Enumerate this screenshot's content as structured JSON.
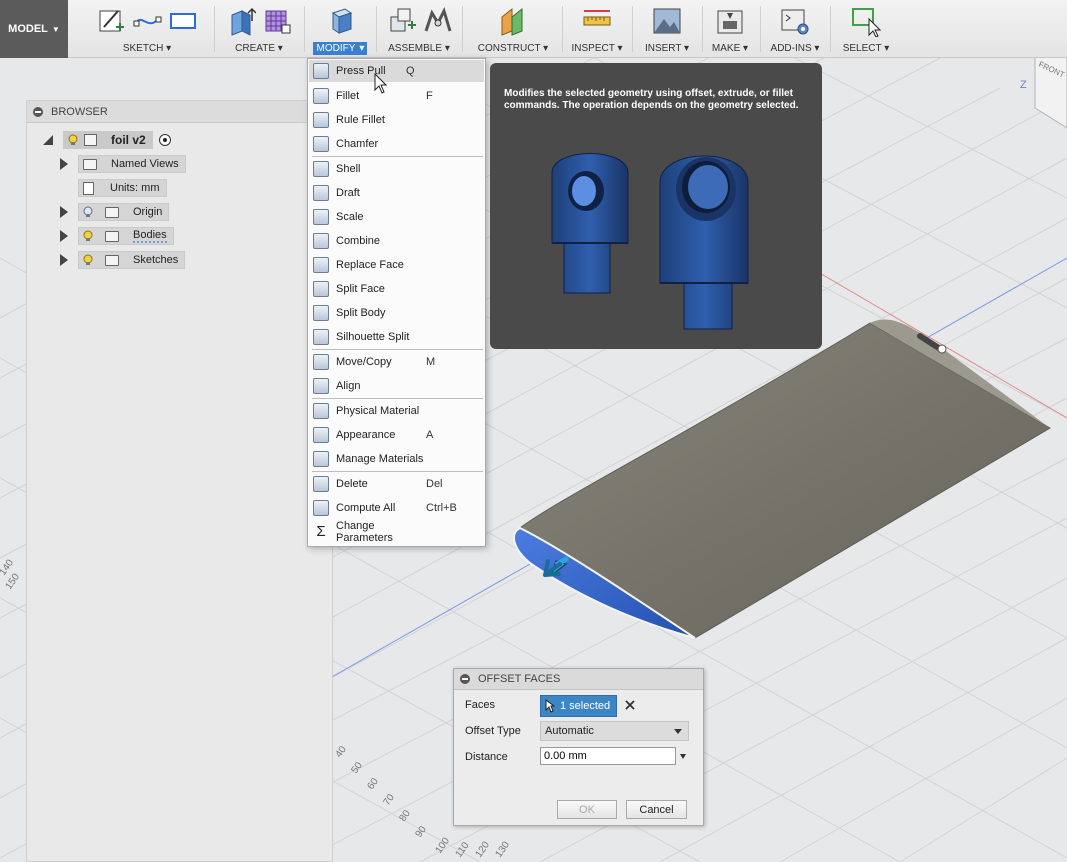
{
  "toolbar": {
    "model_label": "MODEL",
    "groups": [
      {
        "label": "SKETCH"
      },
      {
        "label": "CREATE"
      },
      {
        "label": "MODIFY"
      },
      {
        "label": "ASSEMBLE"
      },
      {
        "label": "CONSTRUCT"
      },
      {
        "label": "INSPECT"
      },
      {
        "label": "INSERT"
      },
      {
        "label": "MAKE"
      },
      {
        "label": "ADD-INS"
      },
      {
        "label": "SELECT"
      }
    ],
    "active_group": "MODIFY"
  },
  "browser": {
    "title": "BROWSER",
    "root": "foil v2",
    "items": [
      {
        "label": "Named Views"
      },
      {
        "label": "Units: mm"
      },
      {
        "label": "Origin"
      },
      {
        "label": "Bodies"
      },
      {
        "label": "Sketches"
      }
    ]
  },
  "modify_menu": {
    "items": [
      {
        "label": "Press Pull",
        "shortcut": "Q",
        "icon": "press-pull-icon"
      },
      {
        "label": "Fillet",
        "shortcut": "F",
        "icon": "fillet-icon"
      },
      {
        "label": "Rule Fillet",
        "shortcut": "",
        "icon": "rule-fillet-icon"
      },
      {
        "label": "Chamfer",
        "shortcut": "",
        "icon": "chamfer-icon"
      },
      {
        "label": "Shell",
        "shortcut": "",
        "icon": "shell-icon"
      },
      {
        "label": "Draft",
        "shortcut": "",
        "icon": "draft-icon"
      },
      {
        "label": "Scale",
        "shortcut": "",
        "icon": "scale-icon"
      },
      {
        "label": "Combine",
        "shortcut": "",
        "icon": "combine-icon"
      },
      {
        "label": "Replace Face",
        "shortcut": "",
        "icon": "replace-face-icon"
      },
      {
        "label": "Split Face",
        "shortcut": "",
        "icon": "split-face-icon"
      },
      {
        "label": "Split Body",
        "shortcut": "",
        "icon": "split-body-icon"
      },
      {
        "label": "Silhouette Split",
        "shortcut": "",
        "icon": "silhouette-split-icon"
      },
      {
        "label": "Move/Copy",
        "shortcut": "M",
        "icon": "move-copy-icon"
      },
      {
        "label": "Align",
        "shortcut": "",
        "icon": "align-icon"
      },
      {
        "label": "Physical Material",
        "shortcut": "",
        "icon": "physical-material-icon"
      },
      {
        "label": "Appearance",
        "shortcut": "A",
        "icon": "appearance-icon"
      },
      {
        "label": "Manage Materials",
        "shortcut": "",
        "icon": "manage-materials-icon"
      },
      {
        "label": "Delete",
        "shortcut": "Del",
        "icon": "delete-icon"
      },
      {
        "label": "Compute All",
        "shortcut": "Ctrl+B",
        "icon": "compute-all-icon"
      },
      {
        "label": "Change Parameters",
        "shortcut": "",
        "icon": "sigma-icon"
      }
    ]
  },
  "tooltip": {
    "text": "Modifies the selected geometry using offset, extrude, or fillet commands. The operation depends on the geometry selected."
  },
  "offset_faces": {
    "title": "OFFSET FACES",
    "faces_label": "Faces",
    "faces_value": "1 selected",
    "offset_type_label": "Offset Type",
    "offset_type_value": "Automatic",
    "distance_label": "Distance",
    "distance_value": "0.00 mm",
    "ok_label": "OK",
    "cancel_label": "Cancel"
  },
  "viewcube": {
    "face": "FRONT",
    "axis": "Z"
  },
  "ruler_ticks": {
    "left": [
      "140",
      "150"
    ],
    "bottom": [
      "40",
      "50",
      "60",
      "70",
      "80",
      "90",
      "100",
      "110",
      "120",
      "130"
    ]
  },
  "colors": {
    "accent": "#3b7fd0",
    "selected_face": "#2f62c4",
    "body": "#77756b"
  }
}
